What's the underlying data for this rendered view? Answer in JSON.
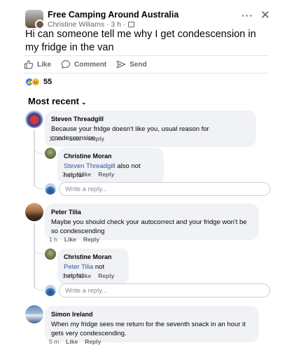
{
  "post": {
    "group_name": "Free Camping Around Australia",
    "author_meta": "Christine Wiliams · 3 h ·",
    "text": "Hi can someone tell me why I get condescension in my fridge in the van",
    "more": "···",
    "close": "✕"
  },
  "actions": {
    "like": "Like",
    "comment": "Comment",
    "send": "Send"
  },
  "reactions": {
    "count": "55"
  },
  "sort": {
    "label": "Most recent",
    "chevron": "⌄"
  },
  "comments": [
    {
      "author": "Steven Threadgill",
      "text": "Because your fridge doesn't like you, usual reason for condescension.",
      "time": "12 m",
      "like": "Like",
      "reply": "Reply",
      "replies": [
        {
          "author": "Christine Moran",
          "mention": "Steven Threadgill",
          "text": " also not helpful",
          "time": "3 m",
          "like": "Like",
          "reply": "Reply"
        }
      ],
      "reply_placeholder": "Write a reply..."
    },
    {
      "author": "Peter Tilia",
      "text": "Maybe you should check your autocorrect and your fridge won't be so condescending",
      "time": "1 h",
      "like": "Like",
      "reply": "Reply",
      "replies": [
        {
          "author": "Christine Moran",
          "mention": "Peter Tilia",
          "text": " not helpful",
          "time": "3 m",
          "like": "Like",
          "reply": "Reply"
        }
      ],
      "reply_placeholder": "Write a reply..."
    },
    {
      "author": "Simon Ireland",
      "text": "When my fridge sees me return for the seventh snack in an hour it gets very condescending.",
      "time": "5 m",
      "like": "Like",
      "reply": "Reply"
    }
  ],
  "colors": {
    "mention": "#385898",
    "like_react": "#1877f2",
    "haha_react": "#f7b125",
    "bubble": "#f0f2f5"
  }
}
